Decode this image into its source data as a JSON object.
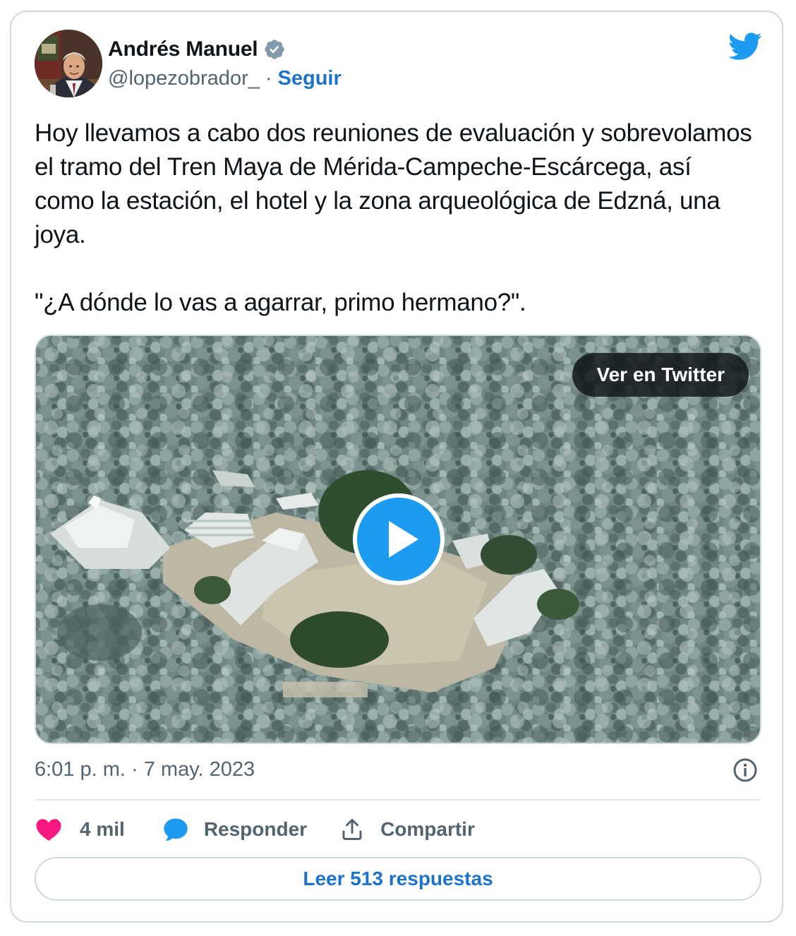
{
  "author": {
    "name": "Andrés Manuel",
    "handle": "@lopezobrador_",
    "separator": "·",
    "follow_label": "Seguir",
    "verified": true
  },
  "icons": {
    "verified": "verified-badge-icon",
    "brand": "twitter-bird-icon",
    "play": "play-icon",
    "info": "info-icon",
    "like": "heart-icon",
    "reply": "speech-bubble-icon",
    "share": "share-upload-icon"
  },
  "colors": {
    "brand_blue": "#1d9bf0",
    "link_blue": "#1d73c9",
    "like_pink": "#f91880",
    "muted_text": "#536471",
    "border": "#cfd9de"
  },
  "tweet": {
    "paragraphs": [
      "Hoy llevamos a cabo dos reuniones de evaluación y sobrevolamos el tramo del Tren Maya de Mérida-Campeche-Escárcega, así como la estación, el hotel y la zona arqueológica de Edzná, una joya.",
      "\"¿A dónde lo vas a agarrar, primo hermano?\"."
    ]
  },
  "media": {
    "type": "video",
    "ver_en_twitter_label": "Ver en Twitter"
  },
  "meta": {
    "timestamp": "6:01 p. m. · 7 may. 2023"
  },
  "actions": {
    "like_count": "4 mil",
    "reply_label": "Responder",
    "share_label": "Compartir"
  },
  "read_replies_label": "Leer 513 respuestas"
}
